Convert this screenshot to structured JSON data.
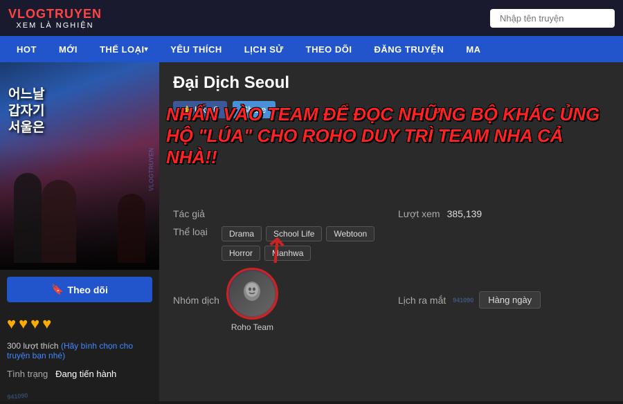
{
  "header": {
    "logo_top": "VLOGTRUYEN",
    "logo_sub": "XEM LÀ NGHIỆN",
    "search_placeholder": "Nhập tên truyện"
  },
  "nav": {
    "items": [
      {
        "label": "HOT",
        "has_arrow": false
      },
      {
        "label": "MỚI",
        "has_arrow": false
      },
      {
        "label": "THỂ LOẠI",
        "has_arrow": true
      },
      {
        "label": "YÊU THÍCH",
        "has_arrow": false
      },
      {
        "label": "LỊCH SỬ",
        "has_arrow": false
      },
      {
        "label": "THEO DÕI",
        "has_arrow": false
      },
      {
        "label": "ĐĂNG TRUYỆN",
        "has_arrow": false
      },
      {
        "label": "MA",
        "has_arrow": false
      }
    ]
  },
  "sidebar": {
    "follow_button": "Theo dõi",
    "hearts": [
      "♥",
      "♥",
      "♥",
      "♥"
    ],
    "likes_count": "300 lượt thích",
    "likes_hint": "(Hãy bình chọn cho truyện bạn nhé)",
    "status_label": "Tình trạng",
    "status_value": "Đang tiến hành"
  },
  "manga": {
    "title": "Đại Dịch Seoul",
    "like_label": "Like 0",
    "share_label": "Share",
    "overlay_line1": "NHẤN VÀO TEAM ĐỂ ĐỌC NHỮNG BỘ KHÁC ỦNG",
    "overlay_line2": "HỘ \"LÚA\" CHO ROHO DUY TRÌ TEAM NHA CẢ NHÀ!!",
    "tac_gia_label": "Tác giả",
    "tac_gia_value": "",
    "luot_xem_label": "Lượt xem",
    "luot_xem_value": "385,139",
    "the_loai_label": "Thể loại",
    "tags": [
      "Drama",
      "School Life",
      "Webtoon",
      "Horror",
      "Manhwa"
    ],
    "nhom_dich_label": "Nhóm dịch",
    "team_name": "Roho Team",
    "lich_ra_mat_label": "Lịch ra mắt",
    "lich_ra_mat_value": "Hàng ngày",
    "watermark": "941090"
  }
}
